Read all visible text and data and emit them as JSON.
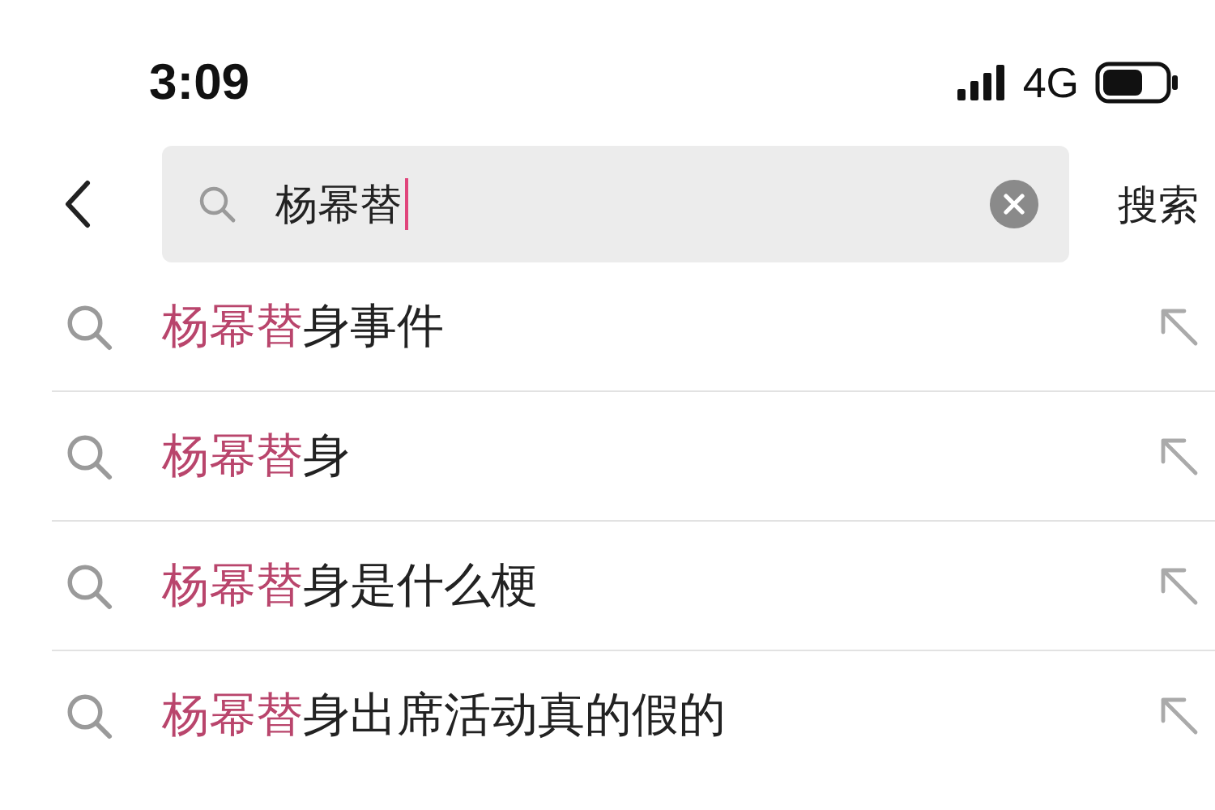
{
  "status_bar": {
    "time": "3:09",
    "network": "4G"
  },
  "search": {
    "value": "杨幂替",
    "focused": true,
    "action": "搜索"
  },
  "suggestions": [
    {
      "match": "杨幂替",
      "rest": "身事件"
    },
    {
      "match": "杨幂替",
      "rest": "身"
    },
    {
      "match": "杨幂替",
      "rest": "身是什么梗"
    },
    {
      "match": "杨幂替",
      "rest": "身出席活动真的假的"
    }
  ]
}
